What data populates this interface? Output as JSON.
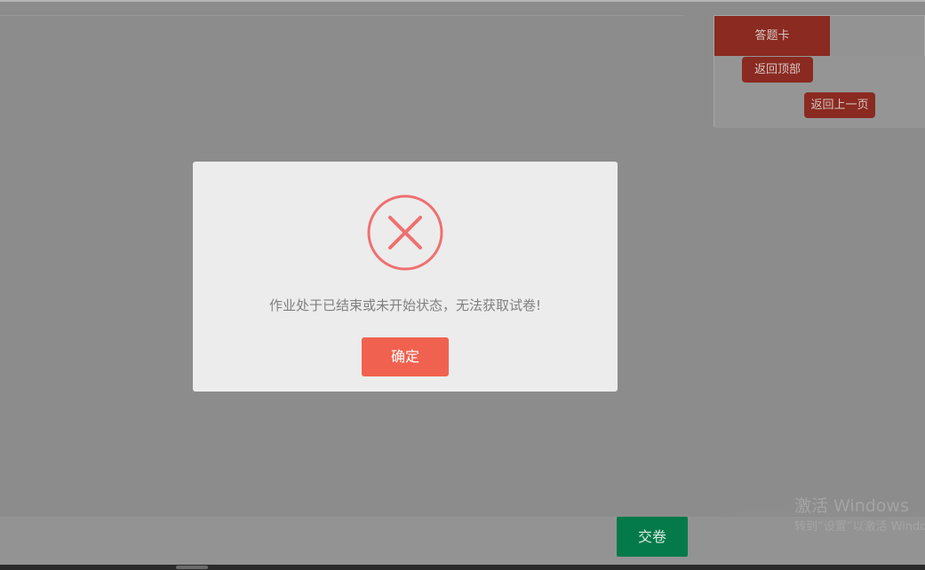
{
  "answer_card": {
    "tab_label": "答题卡",
    "back_to_top_label": "返回顶部",
    "back_to_prev_label": "返回上一页"
  },
  "modal": {
    "icon": "error-circle-x-icon",
    "message": "作业处于已结束或未开始状态，无法获取试卷!",
    "confirm_label": "确定"
  },
  "bottom_bar": {
    "submit_label": "交卷"
  },
  "watermark": {
    "line1": "激活 Windows",
    "line2": "转到“设置”以激活 Windows。"
  },
  "colors": {
    "overlay_gray": "#8c8c8c",
    "answer_card_red": "#8a2a21",
    "submit_green": "#047a4a",
    "confirm_orange": "#f0624f",
    "error_red": "#f07070"
  }
}
